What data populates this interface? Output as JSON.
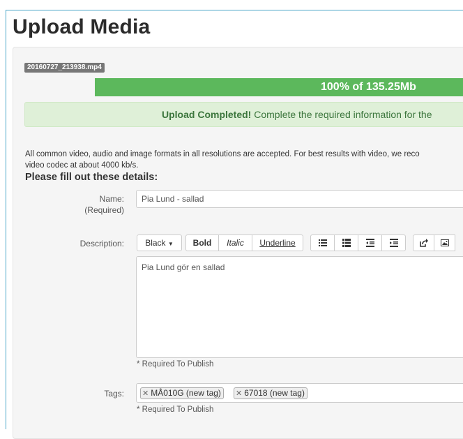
{
  "page": {
    "title": "Upload Media"
  },
  "upload": {
    "filename": "20160727_213938.mp4",
    "progress_percent": 100,
    "progress_text": "100% of 135.25Mb",
    "alert_bold": "Upload Completed!",
    "alert_text": " Complete the required information for the",
    "info_text": "All common video, audio and image formats in all resolutions are accepted.  For best results with video, we reco\nvideo codec at about 4000 kb/s."
  },
  "form": {
    "section_title": "Please fill out these details:",
    "name_label": "Name:",
    "name_required": "(Required)",
    "name_value": "Pia Lund - sallad",
    "description_label": "Description:",
    "description_value": "Pia Lund gör en sallad",
    "description_required_note": "* Required To Publish",
    "tags_label": "Tags:",
    "tags": [
      {
        "label": "MÅ010G (new tag)"
      },
      {
        "label": "67018 (new tag)"
      }
    ],
    "tags_required_note": "* Required To Publish"
  },
  "toolbar": {
    "color_label": "Black",
    "bold_label": "Bold",
    "italic_label": "Italic",
    "underline_label": "Underline",
    "icons": [
      "unordered-list-icon",
      "ordered-list-icon",
      "outdent-icon",
      "indent-icon",
      "link-icon",
      "image-icon"
    ]
  },
  "colors": {
    "progress": "#5cb85c",
    "alert_bg": "#dff0d8",
    "alert_text": "#3c763d"
  }
}
